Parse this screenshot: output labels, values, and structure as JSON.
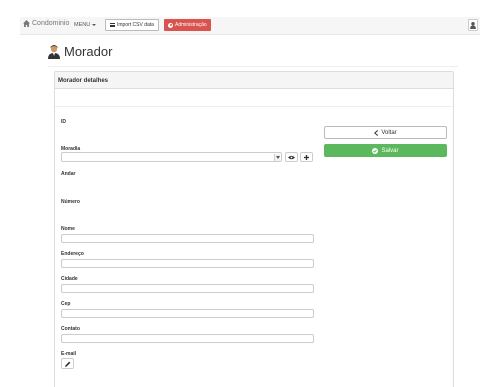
{
  "navbar": {
    "brand": "Condominio",
    "menu_label": "MENU",
    "import_label": "Import CSV data",
    "admin_label": "Administração"
  },
  "page": {
    "title": "Morador"
  },
  "panel": {
    "heading": "Morador detalhes",
    "fields": {
      "id_label": "ID",
      "moradia_label": "Moradia",
      "andar_label": "Andar",
      "numero_label": "Número",
      "nome_label": "Nome",
      "endereco_label": "Endereço",
      "cidade_label": "Cidade",
      "cep_label": "Cep",
      "contato_label": "Contato",
      "email_label": "E-mail"
    },
    "actions": {
      "voltar_label": "Voltar",
      "salvar_label": "Salvar"
    }
  },
  "colors": {
    "admin": "#d9534f",
    "success": "#5cb85c"
  },
  "icons": [
    "home-icon",
    "list-icon",
    "gear-icon",
    "user-icon",
    "person-avatar-icon",
    "eye-icon",
    "plus-icon",
    "chevron-left-icon",
    "ok-circle-icon",
    "pencil-icon"
  ]
}
